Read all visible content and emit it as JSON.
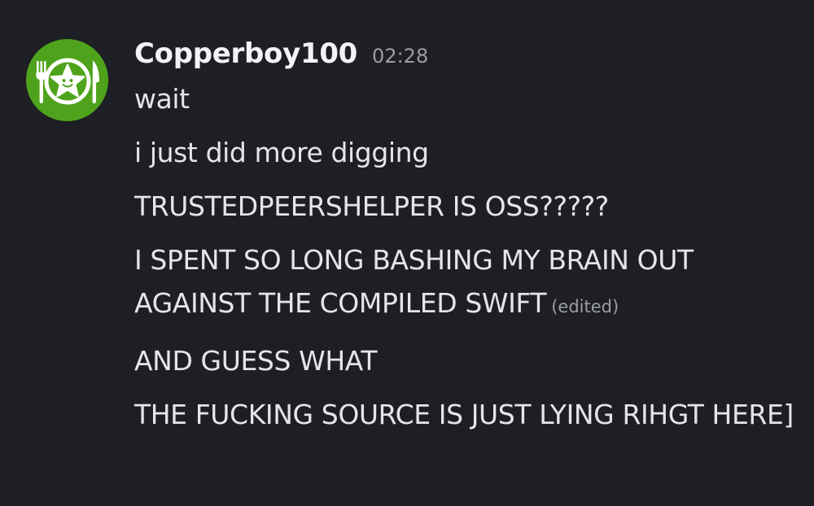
{
  "user": {
    "name": "Copperboy100",
    "timestamp": "02:28",
    "avatar_color": "#4fa31c",
    "avatar_icon": "plate-star-fork-knife-icon"
  },
  "messages": [
    {
      "text": "wait",
      "edited": ""
    },
    {
      "text": "i just did more digging",
      "edited": ""
    },
    {
      "text": "TRUSTEDPEERSHELPER IS OSS?????",
      "edited": ""
    },
    {
      "text": "I SPENT SO LONG BASHING MY BRAIN OUT AGAINST THE COMPILED SWIFT",
      "edited": "(edited)"
    },
    {
      "text": "AND GUESS WHAT",
      "edited": ""
    },
    {
      "text": "THE FUCKING SOURCE IS JUST LYING RIHGT HERE]",
      "edited": ""
    }
  ],
  "theme": {
    "background": "#1e1f24",
    "text": "#e4e5e9",
    "muted": "#9b9da5"
  }
}
